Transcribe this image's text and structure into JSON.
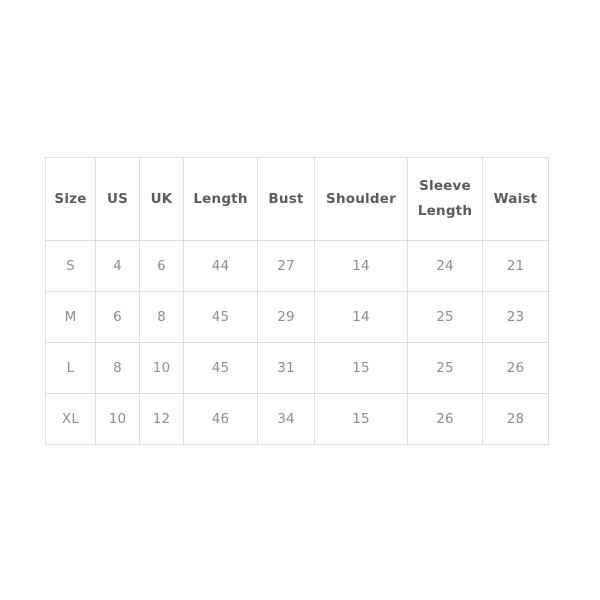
{
  "chart_data": {
    "type": "table",
    "title": "",
    "columns": [
      "Size",
      "US",
      "UK",
      "Length",
      "Bust",
      "Shoulder",
      "Sleeve Length",
      "Waist"
    ],
    "rows": [
      [
        "S",
        "4",
        "6",
        "44",
        "27",
        "14",
        "24",
        "21"
      ],
      [
        "M",
        "6",
        "8",
        "45",
        "29",
        "14",
        "25",
        "23"
      ],
      [
        "L",
        "8",
        "10",
        "45",
        "31",
        "15",
        "25",
        "26"
      ],
      [
        "XL",
        "10",
        "12",
        "46",
        "34",
        "15",
        "26",
        "28"
      ]
    ]
  },
  "table": {
    "headers": [
      {
        "label": "Size",
        "lines": [
          "Size"
        ]
      },
      {
        "label": "US",
        "lines": [
          "US"
        ]
      },
      {
        "label": "UK",
        "lines": [
          "UK"
        ]
      },
      {
        "label": "Length",
        "lines": [
          "Length"
        ]
      },
      {
        "label": "Bust",
        "lines": [
          "Bust"
        ]
      },
      {
        "label": "Shoulder",
        "lines": [
          "Shoulder"
        ]
      },
      {
        "label": "Sleeve Length",
        "lines": [
          "Sleeve",
          "Length"
        ]
      },
      {
        "label": "Waist",
        "lines": [
          "Waist"
        ]
      }
    ],
    "rows": [
      {
        "size": "S",
        "us": "4",
        "uk": "6",
        "length": "44",
        "bust": "27",
        "shoulder": "14",
        "sleeve_length": "24",
        "waist": "21"
      },
      {
        "size": "M",
        "us": "6",
        "uk": "8",
        "length": "45",
        "bust": "29",
        "shoulder": "14",
        "sleeve_length": "25",
        "waist": "23"
      },
      {
        "size": "L",
        "us": "8",
        "uk": "10",
        "length": "45",
        "bust": "31",
        "shoulder": "15",
        "sleeve_length": "25",
        "waist": "26"
      },
      {
        "size": "XL",
        "us": "10",
        "uk": "12",
        "length": "46",
        "bust": "34",
        "shoulder": "15",
        "sleeve_length": "26",
        "waist": "28"
      }
    ]
  },
  "colors": {
    "page_background": "#ffffff",
    "cell_background": "#ffffff",
    "border": "#dedede",
    "header_text": "#5c5c5c",
    "body_text": "#8d8d8d"
  }
}
